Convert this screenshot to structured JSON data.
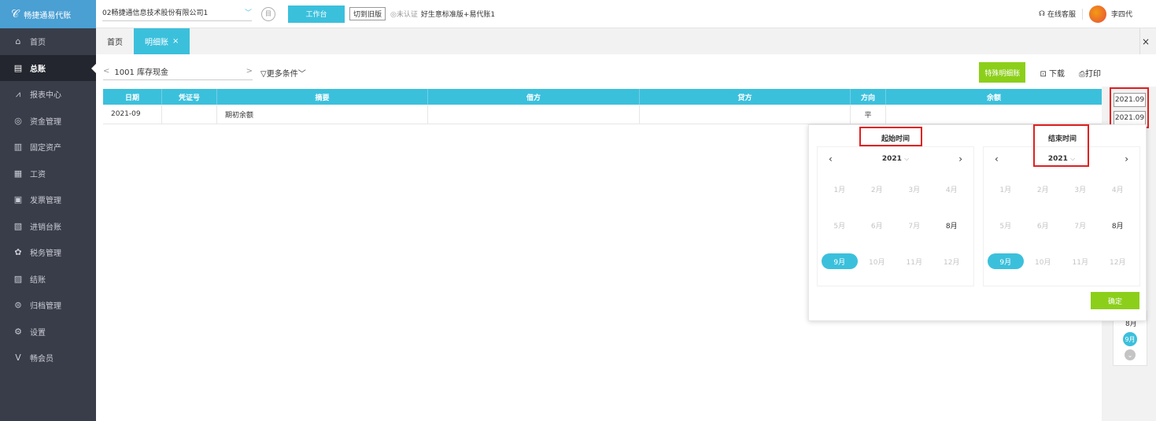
{
  "app": {
    "logo_text": "畅捷通易代账"
  },
  "sidebar": {
    "items": [
      {
        "label": "首页",
        "icon": "home-icon",
        "glyph": "⌂"
      },
      {
        "label": "总账",
        "icon": "ledger-icon",
        "glyph": "▤"
      },
      {
        "label": "报表中心",
        "icon": "chart-icon",
        "glyph": "⩘"
      },
      {
        "label": "资金管理",
        "icon": "money-icon",
        "glyph": "◎"
      },
      {
        "label": "固定资产",
        "icon": "asset-icon",
        "glyph": "▥"
      },
      {
        "label": "工资",
        "icon": "salary-icon",
        "glyph": "▦"
      },
      {
        "label": "发票管理",
        "icon": "invoice-icon",
        "glyph": "▣"
      },
      {
        "label": "进销台账",
        "icon": "inventory-icon",
        "glyph": "▧"
      },
      {
        "label": "税务管理",
        "icon": "tax-icon",
        "glyph": "✿"
      },
      {
        "label": "结账",
        "icon": "close-books-icon",
        "glyph": "▨"
      },
      {
        "label": "归档管理",
        "icon": "archive-icon",
        "glyph": "⊜"
      },
      {
        "label": "设置",
        "icon": "settings-icon",
        "glyph": "⚙"
      },
      {
        "label": "畅会员",
        "icon": "member-icon",
        "glyph": "V"
      }
    ],
    "active_index": 1
  },
  "topbar": {
    "company": "02畅捷通信息技术股份有限公司1",
    "workbench": "工作台",
    "switch_old": "切到旧版",
    "auth_status": "◎未认证",
    "edition": "好生意标准版+易代账1",
    "support": "在线客服",
    "user": "李四代"
  },
  "tabs": [
    {
      "label": "首页"
    },
    {
      "label": "明细账"
    }
  ],
  "toolbar": {
    "account": "1001 库存现金",
    "more_filters": "▽更多条件",
    "special_detail": "特殊明细账",
    "download": "下载",
    "print": "打印"
  },
  "table": {
    "headers": [
      "日期",
      "凭证号",
      "摘要",
      "借方",
      "贷方",
      "方向",
      "余额"
    ],
    "rows": [
      [
        "2021-09",
        "",
        "期初余额",
        "",
        "",
        "平",
        ""
      ]
    ]
  },
  "range": {
    "start": "2021.09",
    "end": "2021.09"
  },
  "picker": {
    "start_title": "起始时间",
    "end_title": "结束时间",
    "year": "2021",
    "months": [
      "1月",
      "2月",
      "3月",
      "4月",
      "5月",
      "6月",
      "7月",
      "8月",
      "9月",
      "10月",
      "11月",
      "12月"
    ],
    "enabled_months": [
      "8月",
      "9月"
    ],
    "selected_month": "9月",
    "confirm": "确定"
  },
  "mini_list": {
    "m8": "8月",
    "m9": "9月"
  },
  "colors": {
    "accent": "#3bc0dc",
    "green": "#8ccf1a",
    "sidebar": "#393d49",
    "annotation": "#e02020"
  }
}
